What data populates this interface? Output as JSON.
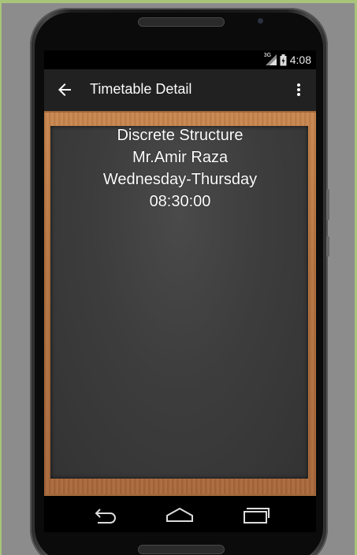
{
  "status_bar": {
    "network": "3G",
    "time": "4:08"
  },
  "app_bar": {
    "title": "Timetable Detail",
    "back_icon": "arrow-back-icon",
    "menu_icon": "more-vert-icon"
  },
  "detail": {
    "course": "Discrete Structure",
    "teacher": "Mr.Amir Raza",
    "days": "Wednesday-Thursday",
    "time": "08:30:00"
  },
  "nav_bar": {
    "back_icon": "nav-back-icon",
    "home_icon": "nav-home-icon",
    "recents_icon": "nav-recents-icon"
  },
  "colors": {
    "app_bar": "#212121",
    "board": "#3d3d3d",
    "wood": "#b67440",
    "frame_accent": "#a9c57a"
  }
}
